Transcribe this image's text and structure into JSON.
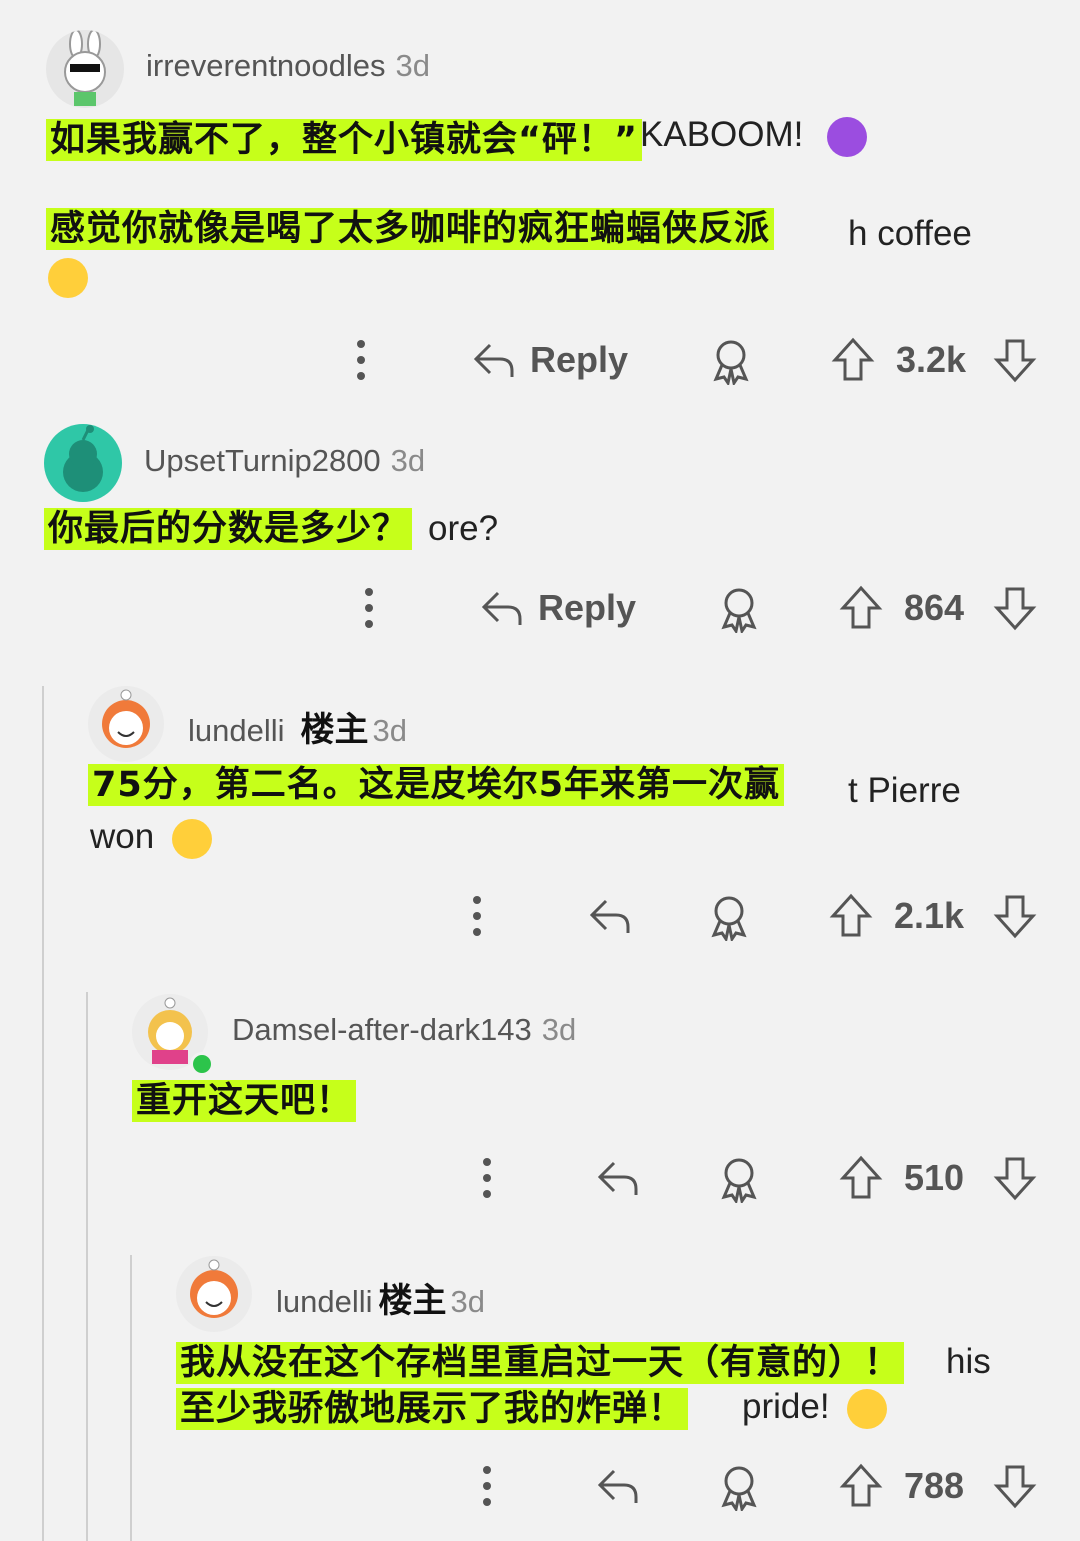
{
  "comments": [
    {
      "username": "irreverentnoodles",
      "time": "3d",
      "original_line1_tail": "KABOOM!",
      "original_line2_tail": "h coffee",
      "translation_line1": "如果我赢不了，整个小镇就会“砰！”",
      "translation_line2": "感觉你就像是喝了太多咖啡的疯狂蝙蝠侠反派",
      "reply_label": "Reply",
      "votes": "3.2k"
    },
    {
      "username": "UpsetTurnip2800",
      "time": "3d",
      "original_line1_tail": "ore?",
      "translation_line1": "你最后的分数是多少？",
      "reply_label": "Reply",
      "votes": "864"
    },
    {
      "username": "lundelli",
      "op_tag": "楼主",
      "time": "3d",
      "original_line1_tail": "t Pierre",
      "original_line2": "won",
      "translation_line1": "75分，第二名。这是皮埃尔5年来第一次赢",
      "votes": "2.1k"
    },
    {
      "username": "Damsel-after-dark143",
      "time": "3d",
      "translation_line1": "重开这天吧！",
      "votes": "510"
    },
    {
      "username": "lundelli",
      "op_tag": "楼主",
      "time": "3d",
      "original_line1_tail": "his",
      "original_line2_tail": "pride!",
      "translation_line1": "我从没在这个存档里重启过一天（有意的）！",
      "translation_line2": "至少我骄傲地展示了我的炸弹！",
      "votes": "788"
    }
  ],
  "icons": {
    "more": "more-vertical-icon",
    "reply": "reply-arrow-icon",
    "award": "award-icon",
    "upvote": "upvote-arrow-icon",
    "downvote": "downvote-arrow-icon",
    "laugh": "laughing-emoji-icon",
    "devil": "smiling-devil-emoji-icon"
  },
  "colors": {
    "highlight": "#c6ff1a",
    "background": "#f2f2f2",
    "icon": "#555555",
    "avatar_teal": "#2fc7a7"
  }
}
